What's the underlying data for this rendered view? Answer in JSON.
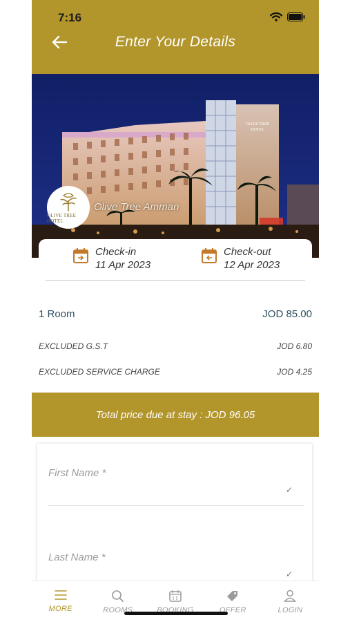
{
  "status": {
    "time": "7:16"
  },
  "header": {
    "title": "Enter Your Details"
  },
  "hotel": {
    "name": "Olive Tree Amman",
    "logo_text": "OLIVE TREE HOTEL",
    "sign_text": "OLIVE TREE HOTEL"
  },
  "dates": {
    "checkin_label": "Check-in",
    "checkin_value": "11 Apr 2023",
    "checkout_label": "Check-out",
    "checkout_value": "12 Apr 2023"
  },
  "pricing": {
    "rooms_label": "1 Room",
    "rooms_price": "JOD 85.00",
    "gst_label": "EXCLUDED G.S.T",
    "gst_price": "JOD 6.80",
    "service_label": "EXCLUDED SERVICE CHARGE",
    "service_price": "JOD 4.25",
    "total_text": "Total price due at stay : JOD 96.05"
  },
  "form": {
    "first_name_placeholder": "First Name *",
    "last_name_placeholder": "Last Name *",
    "check_mark": "✓"
  },
  "tabs": [
    {
      "label": "MORE",
      "icon": "menu-icon"
    },
    {
      "label": "ROOMS",
      "icon": "search-icon"
    },
    {
      "label": "BOOKING",
      "icon": "calendar-icon"
    },
    {
      "label": "OFFER",
      "icon": "tag-icon"
    },
    {
      "label": "LOGIN",
      "icon": "user-icon"
    }
  ],
  "colors": {
    "accent": "#b2952b",
    "night_sky": "#1a2a6e"
  }
}
